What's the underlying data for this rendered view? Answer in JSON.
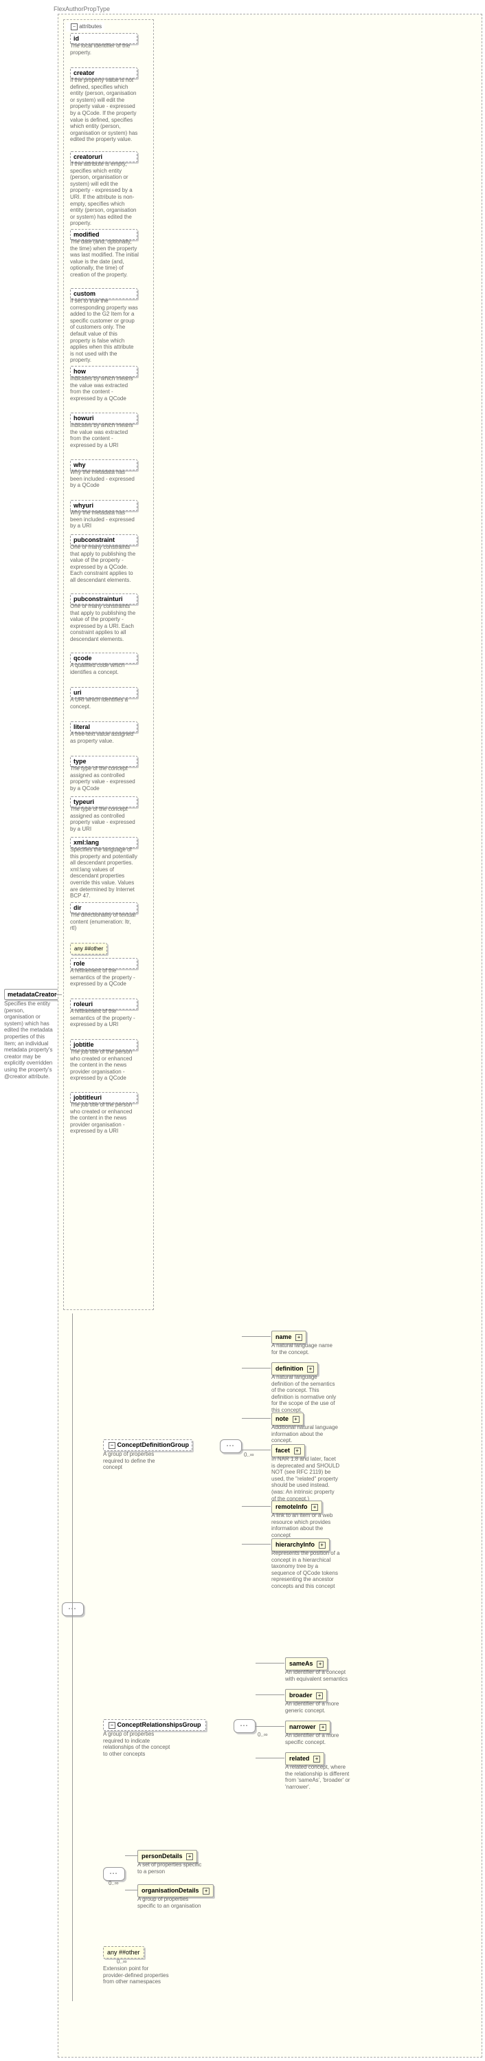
{
  "title": "FlexAuthorPropType",
  "root": {
    "name": "metadataCreator",
    "desc": "Specifies the entity (person, organisation or system) which has edited the metadata properties of this Item; an individual metadata property's creator may be explicitly overridden using the property's @creator attribute."
  },
  "attributes_label": "attributes",
  "attrs": [
    {
      "n": "id",
      "d": "The local identifier of the property."
    },
    {
      "n": "creator",
      "d": "If the property value is not defined, specifies which entity (person, organisation or system) will edit the property value - expressed by a QCode. If the property value is defined, specifies which entity (person, organisation or system) has edited the property value."
    },
    {
      "n": "creatoruri",
      "d": "If the attribute is empty, specifies which entity (person, organisation or system) will edit the property - expressed by a URI. If the attribute is non-empty, specifies which entity (person, organisation or system) has edited the property."
    },
    {
      "n": "modified",
      "d": "The date (and, optionally, the time) when the property was last modified. The initial value is the date (and, optionally, the time) of creation of the property."
    },
    {
      "n": "custom",
      "d": "If set to true the corresponding property was added to the G2 Item for a specific customer or group of customers only. The default value of this property is false which applies when this attribute is not used with the property."
    },
    {
      "n": "how",
      "d": "Indicates by which means the value was extracted from the content - expressed by a QCode"
    },
    {
      "n": "howuri",
      "d": "Indicates by which means the value was extracted from the content - expressed by a URI"
    },
    {
      "n": "why",
      "d": "Why the metadata has been included - expressed by a QCode"
    },
    {
      "n": "whyuri",
      "d": "Why the metadata has been included - expressed by a URI"
    },
    {
      "n": "pubconstraint",
      "d": "One or many constraints that apply to publishing the value of the property - expressed by a QCode. Each constraint applies to all descendant elements."
    },
    {
      "n": "pubconstrainturi",
      "d": "One or many constraints that apply to publishing the value of the property - expressed by a URI. Each constraint applies to all descendant elements."
    },
    {
      "n": "qcode",
      "d": "A qualified code which identifies a concept."
    },
    {
      "n": "uri",
      "d": "A URI which identifies a concept."
    },
    {
      "n": "literal",
      "d": "A free-text value assigned as property value."
    },
    {
      "n": "type",
      "d": "The type of the concept assigned as controlled property value - expressed by a QCode"
    },
    {
      "n": "typeuri",
      "d": "The type of the concept assigned as controlled property value - expressed by a URI"
    },
    {
      "n": "xml:lang",
      "d": "Specifies the language of this property and potentially all descendant properties. xml:lang values of descendant properties override this value. Values are determined by Internet BCP 47."
    },
    {
      "n": "dir",
      "d": "The directionality of textual content (enumeration: ltr, rtl)"
    }
  ],
  "any_other": "any ##other",
  "attrs2": [
    {
      "n": "role",
      "d": "A refinement of the semantics of the property - expressed by a QCode"
    },
    {
      "n": "roleuri",
      "d": "A refinement of the semantics of the property - expressed by a URI"
    },
    {
      "n": "jobtitle",
      "d": "The job title of the person who created or enhanced the content in the news provider organisation - expressed by a QCode"
    },
    {
      "n": "jobtitleuri",
      "d": "The job title of the person who created or enhanced the content in the news provider organisation - expressed by a URI"
    }
  ],
  "groups": {
    "cdg": {
      "n": "ConceptDefinitionGroup",
      "d": "A group of properties required to define the concept",
      "card": "0..∞"
    },
    "crg": {
      "n": "ConceptRelationshipsGroup",
      "d": "A group of properties required to indicate relationships of the concept to other concepts",
      "card": "0..∞"
    }
  },
  "cdg_children": [
    {
      "n": "name",
      "d": "A natural language name for the concept."
    },
    {
      "n": "definition",
      "d": "A natural language definition of the semantics of the concept. This definition is normative only for the scope of the use of this concept."
    },
    {
      "n": "note",
      "d": "Additional natural language information about the concept."
    },
    {
      "n": "facet",
      "d": "In NAR 1.8 and later, facet is deprecated and SHOULD NOT (see RFC 2119) be used, the \"related\" property should be used instead. (was: An intrinsic property of the concept.)"
    },
    {
      "n": "remoteInfo",
      "d": "A link to an item or a web resource which provides information about the concept"
    },
    {
      "n": "hierarchyInfo",
      "d": "Represents the position of a concept in a hierarchical taxonomy tree by a sequence of QCode tokens representing the ancestor concepts and this concept"
    }
  ],
  "crg_children": [
    {
      "n": "sameAs",
      "d": "An identifier of a concept with equivalent semantics"
    },
    {
      "n": "broader",
      "d": "An identifier of a more generic concept."
    },
    {
      "n": "narrower",
      "d": "An identifier of a more specific concept."
    },
    {
      "n": "related",
      "d": "A related concept, where the relationship is different from 'sameAs', 'broader' or 'narrower'."
    }
  ],
  "details": [
    {
      "n": "personDetails",
      "d": "A set of properties specific to a person"
    },
    {
      "n": "organisationDetails",
      "d": "A group of properties specific to an organisation"
    }
  ],
  "details_card": "0..∞",
  "ext": {
    "n": "any ##other",
    "d": "Extension point for provider-defined properties from other namespaces",
    "card": "0..∞"
  }
}
